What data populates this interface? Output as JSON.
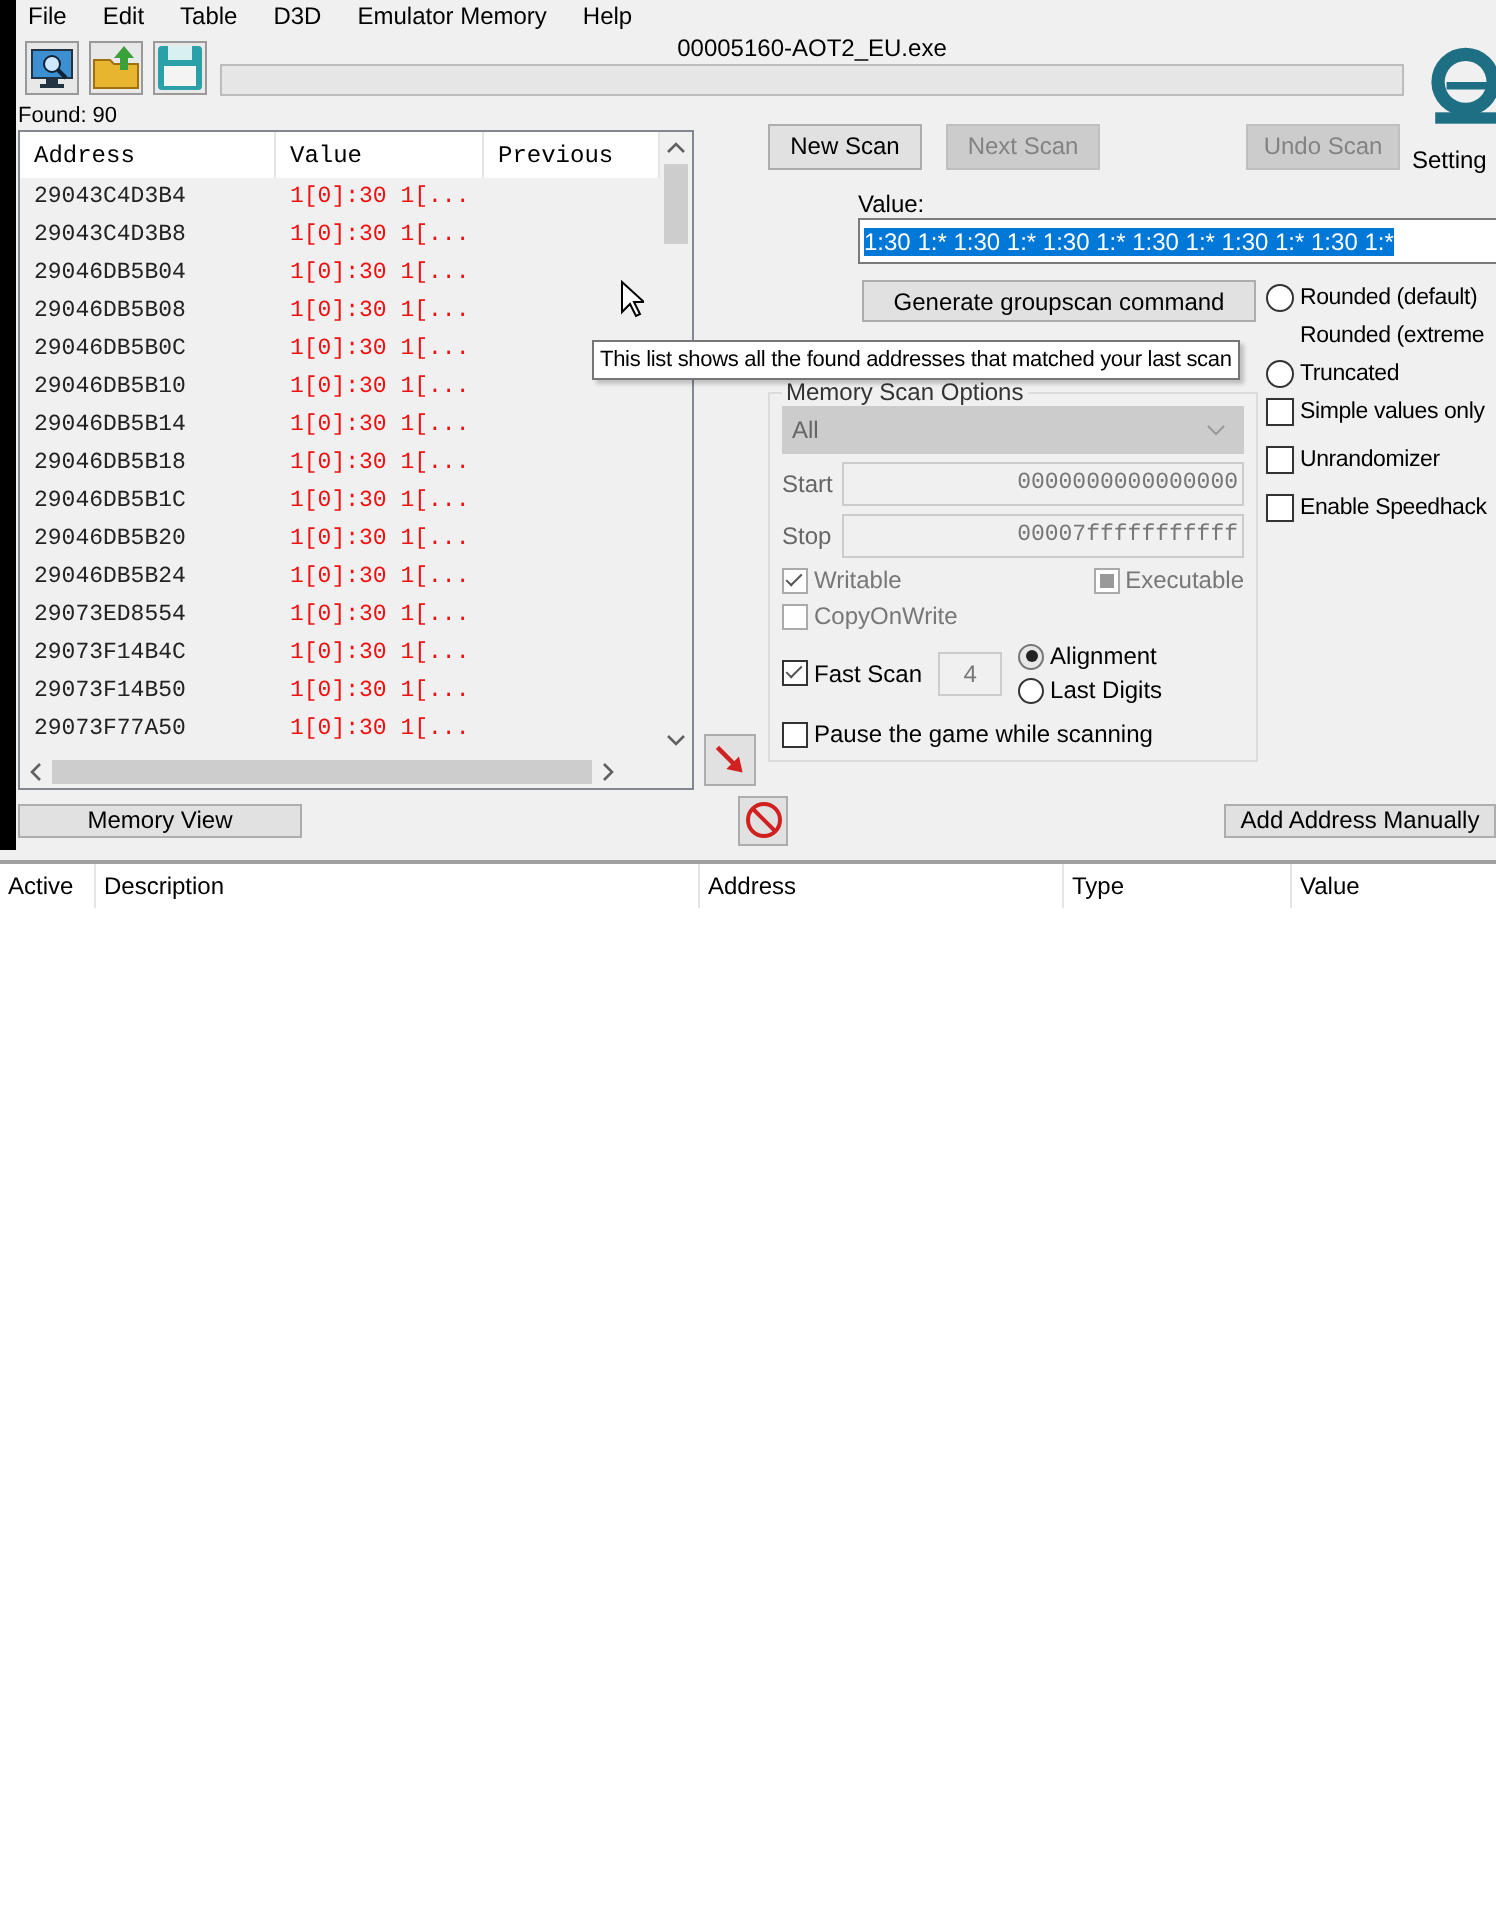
{
  "menu": [
    "File",
    "Edit",
    "Table",
    "D3D",
    "Emulator Memory",
    "Help"
  ],
  "header": {
    "title": "00005160-AOT2_EU.exe",
    "progress": {
      "level": 0
    }
  },
  "found": "Found: 90",
  "settings_label": "Setting",
  "results": {
    "columns": [
      "Address",
      "Value",
      "Previous"
    ],
    "rows": [
      {
        "address": "29043C4D3B4",
        "value": "1[0]:30 1[..."
      },
      {
        "address": "29043C4D3B8",
        "value": "1[0]:30 1[..."
      },
      {
        "address": "29046DB5B04",
        "value": "1[0]:30 1[..."
      },
      {
        "address": "29046DB5B08",
        "value": "1[0]:30 1[..."
      },
      {
        "address": "29046DB5B0C",
        "value": "1[0]:30 1[..."
      },
      {
        "address": "29046DB5B10",
        "value": "1[0]:30 1[..."
      },
      {
        "address": "29046DB5B14",
        "value": "1[0]:30 1[..."
      },
      {
        "address": "29046DB5B18",
        "value": "1[0]:30 1[..."
      },
      {
        "address": "29046DB5B1C",
        "value": "1[0]:30 1[..."
      },
      {
        "address": "29046DB5B20",
        "value": "1[0]:30 1[..."
      },
      {
        "address": "29046DB5B24",
        "value": "1[0]:30 1[..."
      },
      {
        "address": "29073ED8554",
        "value": "1[0]:30 1[..."
      },
      {
        "address": "29073F14B4C",
        "value": "1[0]:30 1[..."
      },
      {
        "address": "29073F14B50",
        "value": "1[0]:30 1[..."
      },
      {
        "address": "29073F77A50",
        "value": "1[0]:30 1[..."
      }
    ]
  },
  "scan_buttons": [
    {
      "label": "New Scan",
      "disabled": false
    },
    {
      "label": "Next Scan",
      "disabled": true
    },
    {
      "label": "Undo Scan",
      "disabled": true
    }
  ],
  "value": {
    "label": "Value:",
    "text": "1:30 1:* 1:30 1:* 1:30 1:* 1:30 1:* 1:30 1:* 1:30 1:*",
    "selected": true
  },
  "groupscan_button": "Generate groupscan command",
  "rounding": [
    {
      "label": "Rounded (default)",
      "selected": false
    },
    {
      "label": "Rounded (extreme"
    },
    {
      "label": "Truncated",
      "selected": false
    }
  ],
  "options": [
    {
      "label": "Simple values only",
      "checked": false
    },
    {
      "label": "Unrandomizer",
      "checked": false
    },
    {
      "label": "Enable Speedhack",
      "checked": false
    }
  ],
  "memory_scan_options": {
    "title": "Memory Scan Options",
    "region": {
      "value": "All",
      "disabled": true
    },
    "start": {
      "label": "Start",
      "value": "0000000000000000"
    },
    "stop": {
      "label": "Stop",
      "value": "00007fffffffffff"
    },
    "writable": {
      "label": "Writable",
      "checked": true,
      "disabled": true
    },
    "executable": {
      "label": "Executable",
      "checked": false,
      "partial": true,
      "disabled": true
    },
    "copy_on_write": {
      "label": "CopyOnWrite",
      "checked": false,
      "disabled": true
    },
    "fast_scan": {
      "label": "Fast Scan",
      "checked": true,
      "value": "4"
    },
    "fast_scan_mode": [
      {
        "label": "Alignment",
        "selected": true
      },
      {
        "label": "Last Digits",
        "selected": false
      }
    ],
    "pause": {
      "label": "Pause the game while scanning",
      "checked": false
    }
  },
  "memory_view_button": "Memory View",
  "add_address_button": "Add Address Manually",
  "address_table": {
    "columns": [
      "Active",
      "Description",
      "Address",
      "Type",
      "Value"
    ]
  },
  "tooltip": "This list shows all the found addresses that matched your last scan"
}
